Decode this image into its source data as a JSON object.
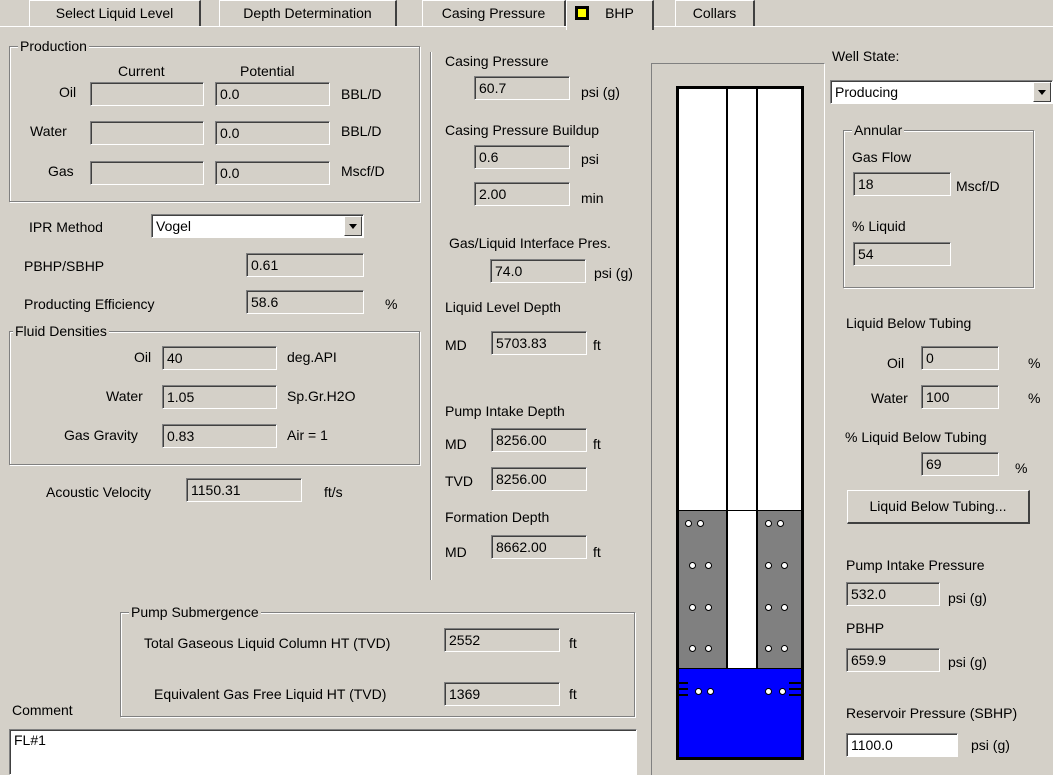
{
  "tabs": [
    {
      "label": "Select Liquid Level"
    },
    {
      "label": "Depth Determination"
    },
    {
      "label": "Casing Pressure"
    },
    {
      "label": "BHP"
    },
    {
      "label": "Collars"
    }
  ],
  "production": {
    "title": "Production",
    "col_current": "Current",
    "col_potential": "Potential",
    "rows": [
      {
        "label": "Oil",
        "current": "",
        "potential": "0.0",
        "unit": "BBL/D"
      },
      {
        "label": "Water",
        "current": "",
        "potential": "0.0",
        "unit": "BBL/D"
      },
      {
        "label": "Gas",
        "current": "",
        "potential": "0.0",
        "unit": "Mscf/D"
      }
    ]
  },
  "ipr": {
    "label": "IPR Method",
    "value": "Vogel"
  },
  "pbhp_sbhp": {
    "label": "PBHP/SBHP",
    "value": "0.61"
  },
  "efficiency": {
    "label": "Producting Efficiency",
    "value": "58.6",
    "unit": "%"
  },
  "fluid": {
    "title": "Fluid Densities",
    "oil": {
      "label": "Oil",
      "value": "40",
      "unit": "deg.API"
    },
    "water": {
      "label": "Water",
      "value": "1.05",
      "unit": "Sp.Gr.H2O"
    },
    "gas": {
      "label": "Gas Gravity",
      "value": "0.83",
      "unit": "Air = 1"
    }
  },
  "acoustic": {
    "label": "Acoustic Velocity",
    "value": "1150.31",
    "unit": "ft/s"
  },
  "casing": {
    "title": "Casing Pressure",
    "value": "60.7",
    "unit": "psi (g)",
    "buildup_title": "Casing Pressure Buildup",
    "buildup_psi": "0.6",
    "buildup_psi_unit": "psi",
    "buildup_min": "2.00",
    "buildup_min_unit": "min",
    "interface_title": "Gas/Liquid Interface Pres.",
    "interface_value": "74.0",
    "interface_unit": "psi (g)"
  },
  "liquid_level": {
    "title": "Liquid Level Depth",
    "md_label": "MD",
    "md_value": "5703.83",
    "unit": "ft"
  },
  "pump_intake": {
    "title": "Pump Intake Depth",
    "md_label": "MD",
    "md_value": "8256.00",
    "unit": "ft",
    "tvd_label": "TVD",
    "tvd_value": "8256.00"
  },
  "formation": {
    "title": "Formation Depth",
    "md_label": "MD",
    "md_value": "8662.00",
    "unit": "ft"
  },
  "submergence": {
    "title": "Pump Submergence",
    "total_label": "Total Gaseous Liquid Column HT  (TVD)",
    "total_value": "2552",
    "total_unit": "ft",
    "equiv_label": "Equivalent Gas Free Liquid HT  (TVD)",
    "equiv_value": "1369",
    "equiv_unit": "ft"
  },
  "comment": {
    "label": "Comment",
    "value": "FL#1"
  },
  "well_state": {
    "label": "Well State:",
    "value": "Producing"
  },
  "annular": {
    "title": "Annular",
    "gas_flow_label": "Gas Flow",
    "gas_flow_value": "18",
    "gas_flow_unit": "Mscf/D",
    "liquid_label": "% Liquid",
    "liquid_value": "54"
  },
  "below_tubing": {
    "title": "Liquid Below Tubing",
    "oil_label": "Oil",
    "oil_value": "0",
    "oil_unit": "%",
    "water_label": "Water",
    "water_value": "100",
    "water_unit": "%",
    "pct_label": "% Liquid Below Tubing",
    "pct_value": "69",
    "pct_unit": "%",
    "button": "Liquid Below Tubing..."
  },
  "pip": {
    "label": "Pump Intake Pressure",
    "value": "532.0",
    "unit": "psi (g)"
  },
  "pbhp": {
    "label": "PBHP",
    "value": "659.9",
    "unit": "psi (g)"
  },
  "reservoir": {
    "label": "Reservoir Pressure (SBHP)",
    "value": "1100.0",
    "unit": "psi (g)"
  },
  "colors": {
    "liquid_blue": "#0000ff",
    "gaseous_gray": "#808080",
    "tab_marker": "#ffff00"
  }
}
